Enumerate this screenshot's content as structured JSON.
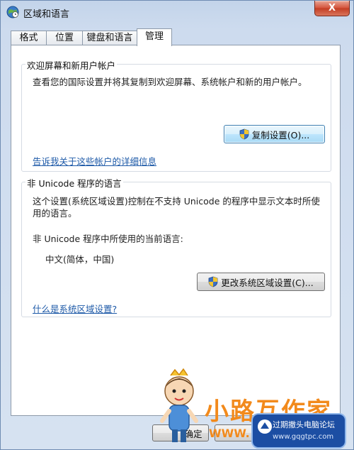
{
  "window": {
    "title": "区域和语言",
    "close_symbol": "X"
  },
  "tabs": [
    {
      "label": "格式",
      "active": false
    },
    {
      "label": "位置",
      "active": false
    },
    {
      "label": "键盘和语言",
      "active": false
    },
    {
      "label": "管理",
      "active": true
    }
  ],
  "welcome_group": {
    "title": "欢迎屏幕和新用户帐户",
    "description": "查看您的国际设置并将其复制到欢迎屏幕、系统帐户和新的用户帐户。",
    "copy_button": "复制设置(O)...",
    "link": "告诉我关于这些帐户的详细信息"
  },
  "unicode_group": {
    "title": "非 Unicode 程序的语言",
    "description_line1": "这个设置(系统区域设置)控制在不支持 Unicode 的程序中显示文本时所使",
    "description_line2": "用的语言。",
    "current_label": "非 Unicode 程序中所使用的当前语言:",
    "current_value": "中文(简体，中国)",
    "change_button": "更改系统区域设置(C)...",
    "link": "什么是系统区域设置?"
  },
  "bottom_buttons": {
    "ok": "确定",
    "cancel": "取"
  },
  "watermark": {
    "site_text": "小路互作家",
    "url_text": "WWW.",
    "badge_text": "过期撤头电脑论坛",
    "badge_url": "www.gqgtpc.com"
  },
  "colors": {
    "accent": "#1e5aa8",
    "close_button": "#c33d23",
    "watermark_orange": "#f28a1c",
    "badge_blue": "#1c4ea3"
  }
}
